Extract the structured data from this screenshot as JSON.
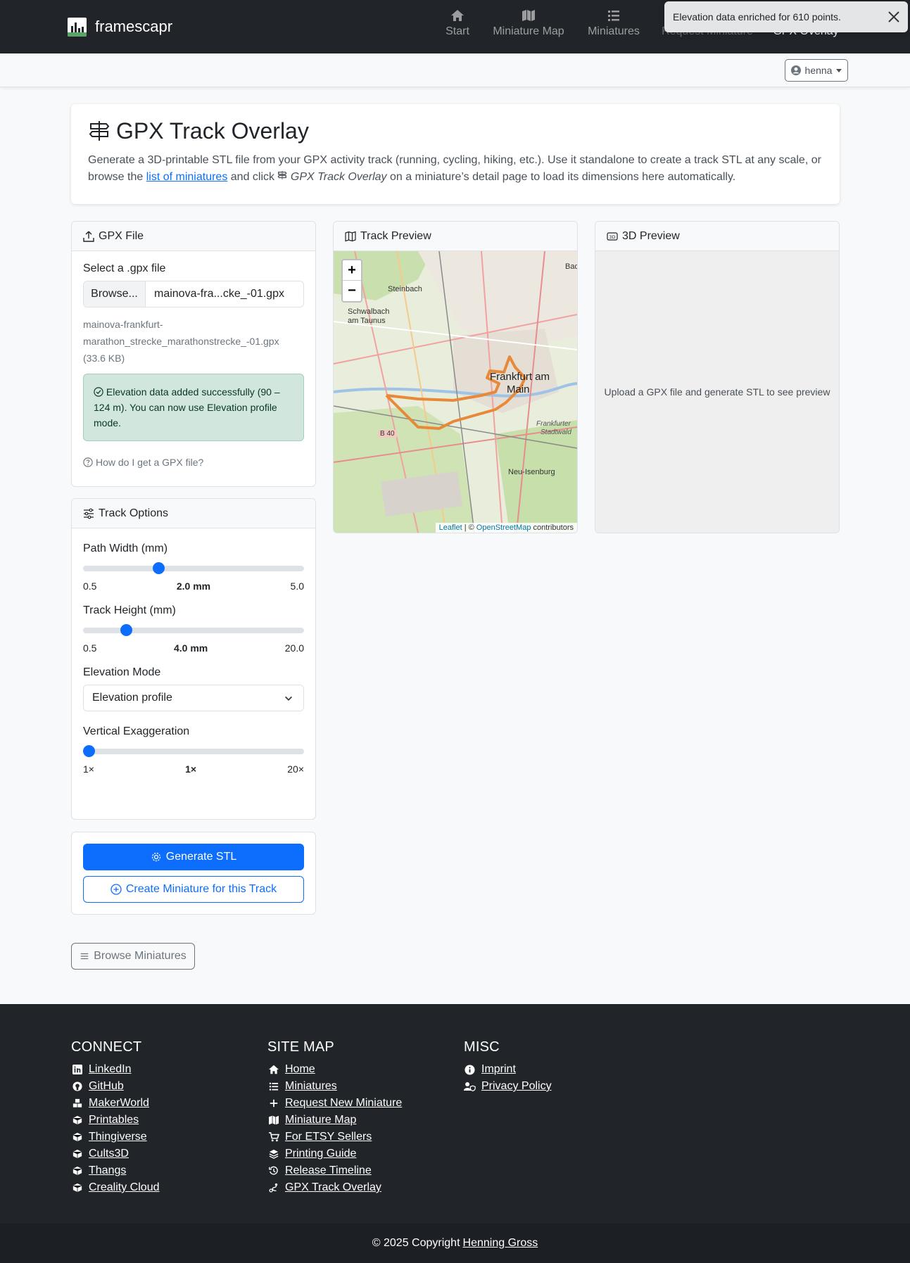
{
  "brand": {
    "name": "framescapr"
  },
  "nav": {
    "items": [
      {
        "label": "Start",
        "icon": "home-icon"
      },
      {
        "label": "Miniature Map",
        "icon": "map-icon"
      },
      {
        "label": "Miniatures",
        "icon": "list-icon"
      },
      {
        "label": "Request Miniature",
        "icon": "plus-icon"
      },
      {
        "label": "GPX Overlay",
        "icon": "route-icon"
      }
    ]
  },
  "toast": {
    "message": "Elevation data enriched for 610 points."
  },
  "user": {
    "name": "henna"
  },
  "hero": {
    "title": "GPX Track Overlay",
    "desc_1": "Generate a 3D-printable STL file from your GPX activity track (running, cycling, hiking, etc.). Use it standalone to create a track STL at any scale, or browse the",
    "link": "list of miniatures",
    "desc_2": "and click",
    "desc_em": "GPX Track Overlay",
    "desc_3": "on a miniature’s detail page to load its dimensions here automatically."
  },
  "gpx_card": {
    "title": "GPX File",
    "select_label": "Select a .gpx file",
    "browse": "Browse...",
    "file_short": "mainova-fra...cke_-01.gpx",
    "file_full": "mainova-frankfurt-marathon_strecke_marathonstrecke_-01.gpx (33.6 KB)",
    "alert": "Elevation data added successfully (90 – 124 m). You can now use Elevation profile mode.",
    "help": "How do I get a GPX file?"
  },
  "options": {
    "title": "Track Options",
    "path_width": {
      "label": "Path Width (mm)",
      "min": "0.5",
      "max": "5.0",
      "value_label": "2.0 mm",
      "value": 2.0,
      "min_v": 0.5,
      "max_v": 5.0
    },
    "track_height": {
      "label": "Track Height (mm)",
      "min": "0.5",
      "max": "20.0",
      "value_label": "4.0 mm",
      "value": 4.0,
      "min_v": 0.5,
      "max_v": 20.0
    },
    "elevation_mode": {
      "label": "Elevation Mode",
      "selected": "Elevation profile"
    },
    "exaggeration": {
      "label": "Vertical Exaggeration",
      "min": "1×",
      "max": "20×",
      "value_label": "1×",
      "value": 1,
      "min_v": 1,
      "max_v": 20
    }
  },
  "actions": {
    "generate": "Generate STL",
    "create": "Create Miniature for this Track",
    "browse": "Browse Miniatures"
  },
  "track_preview": {
    "title": "Track Preview",
    "places": [
      "Steinbach",
      "Schwalbach",
      "am Taunus",
      "Frankfurt am",
      "Main",
      "Frankfurter",
      "Stadtwald",
      "Neu-Isenburg",
      "B 40",
      "Bad"
    ],
    "attribution": {
      "leaflet": "Leaflet",
      "sep": "| ©",
      "osm": "OpenStreetMap",
      "contrib": "contributors"
    }
  },
  "preview3d": {
    "title": "3D Preview",
    "placeholder": "Upload a GPX file and generate STL to see preview"
  },
  "footer": {
    "connect": {
      "title": "CONNECT",
      "links": [
        "LinkedIn",
        "GitHub",
        "MakerWorld",
        "Printables",
        "Thingiverse",
        "Cults3D",
        "Thangs",
        "Creality Cloud"
      ]
    },
    "sitemap": {
      "title": "SITE MAP",
      "links": [
        "Home",
        "Miniatures",
        "Request New Miniature",
        "Miniature Map",
        "For ETSY Sellers",
        "Printing Guide",
        "Release Timeline",
        "GPX Track Overlay"
      ]
    },
    "misc": {
      "title": "MISC",
      "links": [
        "Imprint",
        "Privacy Policy"
      ]
    },
    "copyright": "© 2025 Copyright",
    "author": "Henning Gross"
  },
  "colors": {
    "primary": "#0d6efd",
    "dark": "#212529",
    "track": "#e8893a",
    "success_bg": "#d1e7dd"
  }
}
